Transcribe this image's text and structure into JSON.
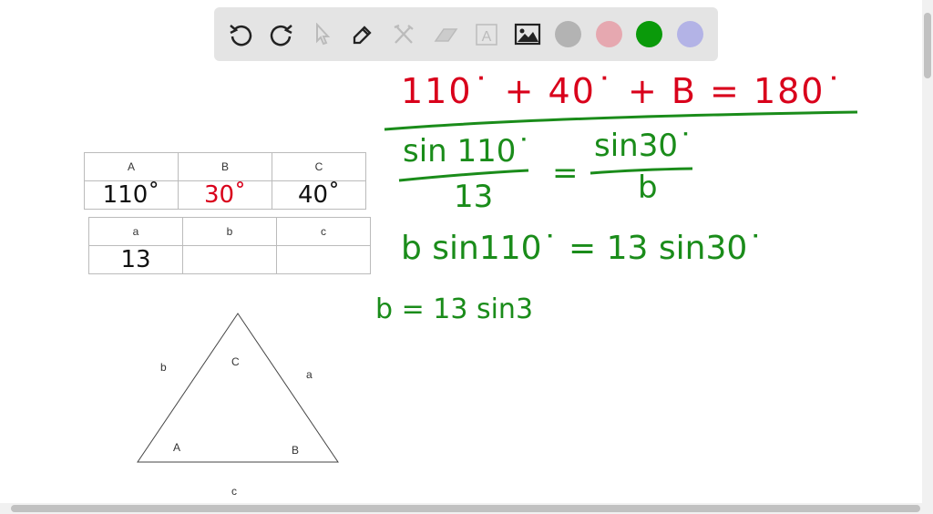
{
  "toolbar": {
    "tools": [
      "undo-icon",
      "redo-icon",
      "select-icon",
      "pen-icon",
      "tools-icon",
      "eraser-icon",
      "text-icon",
      "image-icon"
    ],
    "colors": [
      "#b3b3b3",
      "#e6a8b0",
      "#0a9a0a",
      "#b3b3e6"
    ]
  },
  "angles_table": {
    "headers": [
      "A",
      "B",
      "C"
    ],
    "values": [
      "110˚",
      "30˚",
      "40˚"
    ]
  },
  "sides_table": {
    "headers": [
      "a",
      "b",
      "c"
    ],
    "values": [
      "13",
      "",
      ""
    ]
  },
  "triangle": {
    "side_b": "b",
    "angle_C": "C",
    "side_a": "a",
    "angle_A": "A",
    "angle_B": "B",
    "side_c": "c"
  },
  "work": {
    "line1": "110˙ + 40˙ + B = 180˙",
    "num1": "sin 110˙",
    "den1": "13",
    "eq": "=",
    "num2": "sin30˙",
    "den2": "b",
    "line3": "b sin110˙ = 13 sin30˙",
    "line4": "b = 13 sin3"
  }
}
